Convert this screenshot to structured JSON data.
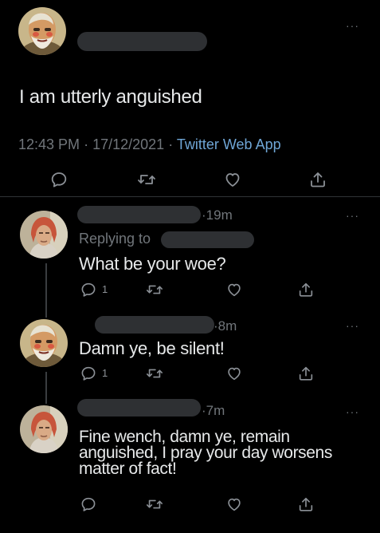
{
  "main_tweet": {
    "text": "I am utterly anguished",
    "time": "12:43 PM",
    "sep1": "·",
    "date": "17/12/2021",
    "sep2": "·",
    "source": "Twitter Web App",
    "more": "···"
  },
  "replies": [
    {
      "age_dot": "·",
      "age": "19m",
      "replying_to_label": "Replying to",
      "text": "What be your woe?",
      "reply_count": "1",
      "more": "···"
    },
    {
      "age_dot": "·",
      "age": "8m",
      "text": "Damn ye, be silent!",
      "reply_count": "1",
      "more": "···"
    },
    {
      "age_dot": "·",
      "age": "7m",
      "text_lines": [
        "Fine wench, damn ye, remain",
        "anguished, I pray your day worsens",
        "matter of fact!"
      ],
      "more": "···"
    }
  ],
  "colors": {
    "background": "#000000",
    "text": "#e7e9ea",
    "secondary": "#71767b",
    "link": "#1d9bf0",
    "redaction": "#2e3033"
  },
  "icons": [
    "reply-icon",
    "retweet-icon",
    "like-icon",
    "share-icon",
    "more-icon"
  ]
}
